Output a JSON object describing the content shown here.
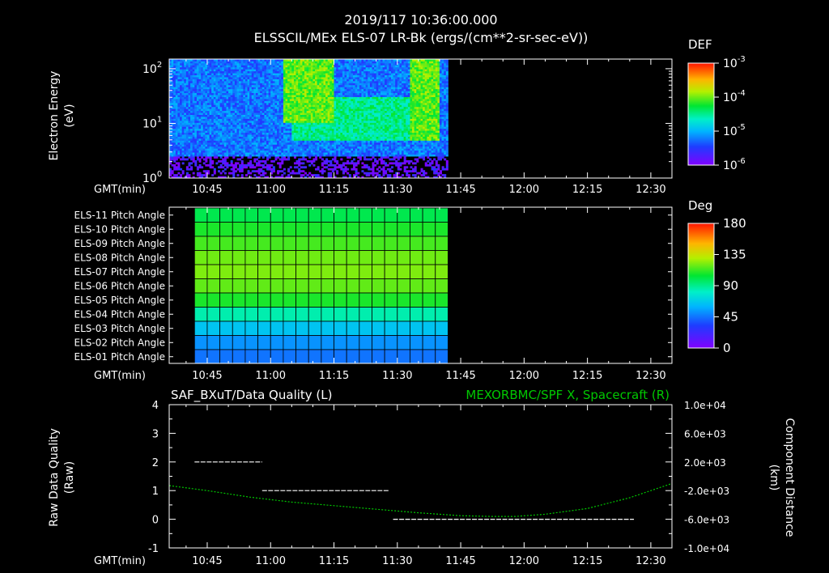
{
  "header": {
    "timestamp": "2019/117 10:36:00.000",
    "title": "ELSSCIL/MEx ELS-07 LR-Bk  (ergs/(cm**2-sr-sec-eV))"
  },
  "colors": {
    "background": "#000000",
    "axis": "#ffffff",
    "spacecraft_series": "#00c800",
    "quality_series": "#ffffff"
  },
  "time_axis": {
    "label": "GMT(min)",
    "tick_labels": [
      "10:45",
      "11:00",
      "11:15",
      "11:30",
      "11:45",
      "12:00",
      "12:15",
      "12:30"
    ],
    "tick_values_min": [
      645,
      660,
      675,
      690,
      705,
      720,
      735,
      750
    ],
    "range_min": [
      636,
      755
    ]
  },
  "chart_data": [
    {
      "type": "heatmap",
      "ylabel_line1": "Electron Energy",
      "ylabel_line2": "(eV)",
      "yscale": "log",
      "ylim": [
        1,
        150
      ],
      "y_tick_bases": [
        "10",
        "10",
        "10"
      ],
      "y_tick_exponents": [
        "0",
        "1",
        "2"
      ],
      "y_tick_values": [
        1,
        10,
        100
      ],
      "data_time_range_min": [
        636,
        702
      ],
      "colorbar": {
        "title": "DEF",
        "scale": "log",
        "range": [
          1e-06,
          0.001
        ],
        "tick_bases": [
          "10",
          "10",
          "10",
          "10"
        ],
        "tick_exponents": [
          "-6",
          "-5",
          "-4",
          "-3"
        ],
        "tick_values": [
          1e-06,
          1e-05,
          0.0001,
          0.001
        ]
      },
      "features": [
        {
          "t_start": 636,
          "t_end": 702,
          "e_low": 2.5,
          "e_high": 150,
          "level": 0.25,
          "note_kind": "background"
        },
        {
          "t_start": 665,
          "t_end": 700,
          "e_low": 5,
          "e_high": 30,
          "level": 0.5,
          "note_kind": "band"
        },
        {
          "t_start": 663,
          "t_end": 675,
          "e_low": 10,
          "e_high": 150,
          "level": 0.65,
          "note_kind": "enhancement"
        },
        {
          "t_start": 693,
          "t_end": 700,
          "e_low": 5,
          "e_high": 150,
          "level": 0.65,
          "note_kind": "enhancement"
        }
      ]
    },
    {
      "type": "heatmap",
      "colorbar": {
        "title": "Deg",
        "range": [
          0,
          180
        ],
        "tick_labels": [
          "0",
          "45",
          "90",
          "135",
          "180"
        ],
        "tick_values": [
          0,
          45,
          90,
          135,
          180
        ]
      },
      "data_time_range_min": [
        642,
        702
      ],
      "cell_width_min": 3,
      "row_labels": [
        "ELS-11 Pitch Angle",
        "ELS-10 Pitch Angle",
        "ELS-09 Pitch Angle",
        "ELS-08 Pitch Angle",
        "ELS-07 Pitch Angle",
        "ELS-06 Pitch Angle",
        "ELS-05 Pitch Angle",
        "ELS-04 Pitch Angle",
        "ELS-03 Pitch Angle",
        "ELS-02 Pitch Angle",
        "ELS-01 Pitch Angle"
      ],
      "row_values_deg": [
        100,
        108,
        114,
        120,
        122,
        118,
        108,
        85,
        65,
        52,
        45
      ]
    },
    {
      "type": "line",
      "left_title": "SAF_BXuT/Data Quality (L)",
      "right_title": "MEXORBMC/SPF X, Spacecraft (R)",
      "ylabel_left_line1": "Raw Data Quality",
      "ylabel_left_line2": "(Raw)",
      "ylabel_right_line1": "Component Distance",
      "ylabel_right_line2": "(km)",
      "ylim_left": [
        -1,
        4
      ],
      "y_left_tick_labels": [
        "-1",
        "0",
        "1",
        "2",
        "3",
        "4"
      ],
      "y_left_tick_values": [
        -1,
        0,
        1,
        2,
        3,
        4
      ],
      "ylim_right": [
        -10000,
        10000
      ],
      "y_right_tick_labels": [
        "-1.0e+04",
        "-6.0e+03",
        "-2.0e+03",
        "2.0e+03",
        "6.0e+03",
        "1.0e+04"
      ],
      "y_right_tick_values": [
        -10000,
        -6000,
        -2000,
        2000,
        6000,
        10000
      ],
      "series": [
        {
          "axis": "left",
          "style": "segments",
          "segments": [
            {
              "t_start": 642,
              "t_end": 658,
              "value": 2
            },
            {
              "t_start": 658,
              "t_end": 688,
              "value": 1
            },
            {
              "t_start": 689,
              "t_end": 746,
              "value": 0
            }
          ]
        },
        {
          "axis": "right",
          "style": "dotted",
          "t": [
            636,
            645,
            655,
            665,
            675,
            685,
            695,
            705,
            712,
            718,
            725,
            735,
            745,
            755
          ],
          "values": [
            -1300,
            -2000,
            -2900,
            -3600,
            -4100,
            -4600,
            -5100,
            -5500,
            -5600,
            -5600,
            -5300,
            -4500,
            -3000,
            -1000
          ]
        }
      ]
    }
  ]
}
